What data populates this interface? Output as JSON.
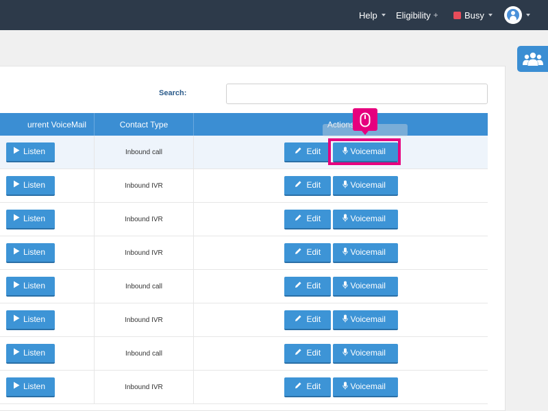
{
  "topbar": {
    "help_label": "Help",
    "eligibility_label": "Eligibility",
    "eligibility_plus": "+",
    "status_label": "Busy",
    "colors": {
      "background": "#2d3a4a",
      "busy": "#e74c5a",
      "accent": "#3b8ed3",
      "highlight": "#e6007e"
    }
  },
  "search": {
    "label": "Search:",
    "value": "",
    "placeholder": ""
  },
  "table": {
    "headers": [
      "urrent VoiceMail",
      "Contact Type",
      "Actions"
    ],
    "listen_label": "Listen",
    "edit_label": "Edit",
    "voicemail_label": "Voicemail",
    "rows": [
      {
        "contact_type": "Inbound call"
      },
      {
        "contact_type": "Inbound IVR"
      },
      {
        "contact_type": "Inbound IVR"
      },
      {
        "contact_type": "Inbound IVR"
      },
      {
        "contact_type": "Inbound call"
      },
      {
        "contact_type": "Inbound IVR"
      },
      {
        "contact_type": "Inbound call"
      },
      {
        "contact_type": "Inbound IVR"
      }
    ]
  },
  "icons": {
    "listen": "play-icon",
    "edit": "pencil-icon",
    "voicemail": "microphone-icon",
    "side": "users-icon",
    "cursor": "mouse-icon"
  }
}
